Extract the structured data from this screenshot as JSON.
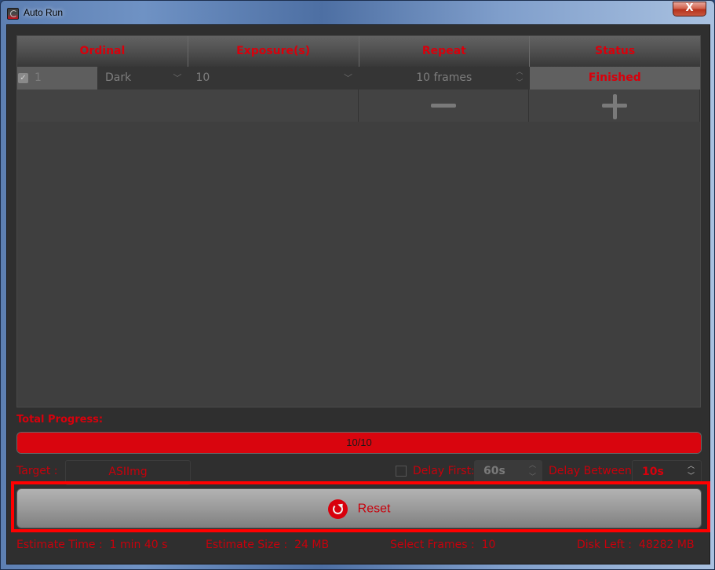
{
  "window": {
    "title": "Auto Run",
    "close_label": "X"
  },
  "table": {
    "headers": [
      "Ordinal",
      "Exposure(s)",
      "Repeat",
      "Status"
    ],
    "rows": [
      {
        "checked": true,
        "ordinal": "1",
        "type": "Dark",
        "exposure": "10",
        "repeat": "10 frames",
        "status": "Finished"
      }
    ],
    "remove_row_label": "remove-row",
    "add_row_label": "add-row"
  },
  "progress": {
    "label": "Total Progress:",
    "current": 10,
    "total": 10,
    "fraction": 1.0,
    "text": "10/10"
  },
  "options": {
    "target_label": "Target :",
    "target_value": "ASIImg",
    "delay_first_checked": false,
    "delay_first_label": "Delay First:",
    "delay_first_value": "60s",
    "delay_between_label": "Delay Between",
    "delay_between_value": "10s"
  },
  "reset_button": {
    "label": "Reset",
    "icon": "refresh-icon"
  },
  "footer": {
    "estimate_time": "Estimate Time :  1 min 40 s",
    "estimate_size": "Estimate Size :  24 MB",
    "select_frames": "Select Frames :  10",
    "disk_left": "Disk Left :  48282 MB"
  },
  "colors": {
    "accent": "#d8000c",
    "highlight": "#ff0000",
    "background": "#2f2f2f"
  }
}
